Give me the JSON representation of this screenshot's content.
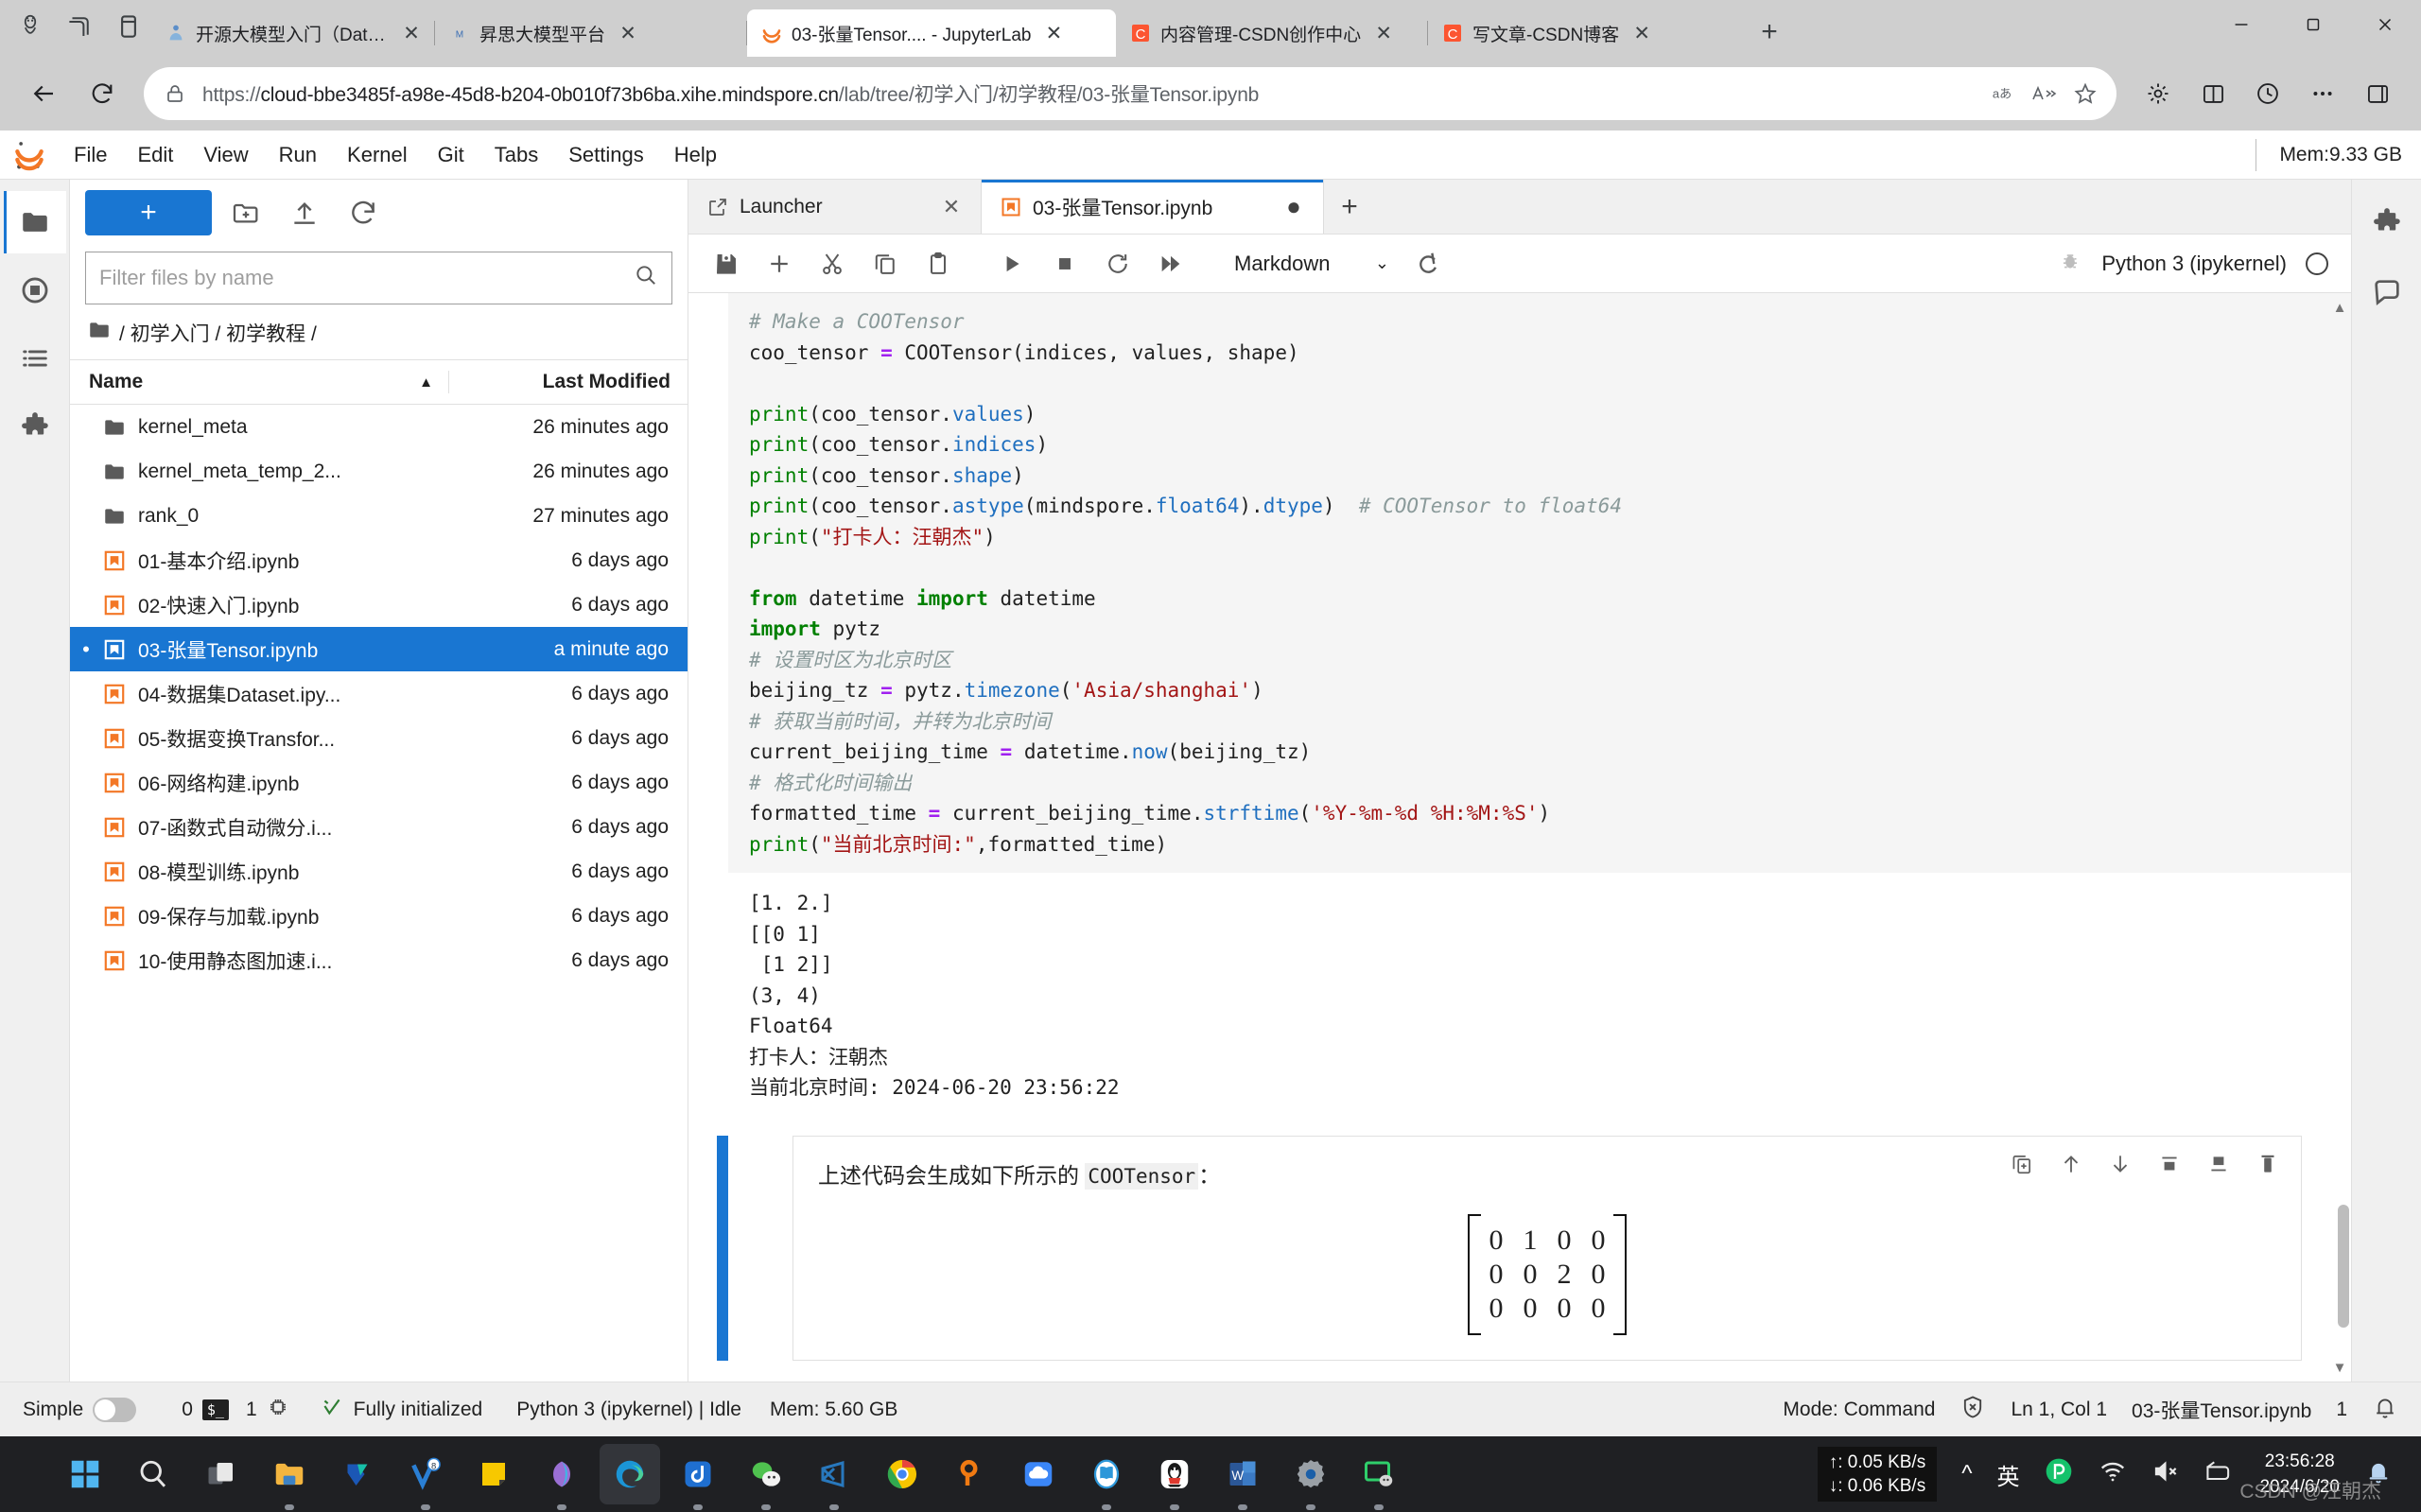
{
  "browser": {
    "tabs": [
      {
        "title": "开源大模型入门（DataWhale）",
        "favicon": "datawhale-icon",
        "active": false
      },
      {
        "title": "昇思大模型平台",
        "favicon": "mindspore-icon",
        "active": false
      },
      {
        "title": "03-张量Tensor.... - JupyterLab",
        "favicon": "jupyter-icon",
        "active": true
      },
      {
        "title": "内容管理-CSDN创作中心",
        "favicon": "csdn-icon",
        "active": false
      },
      {
        "title": "写文章-CSDN博客",
        "favicon": "csdn-icon",
        "active": false
      }
    ],
    "close_label": "✕",
    "newtab_label": "+",
    "window_controls": {
      "minimize": "—",
      "maximize": "❐",
      "close": "✕"
    },
    "url_secure": "https://",
    "url_host": "cloud-bbe3485f-a98e-45d8-b204-0b010f73b6ba.xihe.mindspore.cn",
    "url_path": "/lab/tree/初学入门/初学教程/03-张量Tensor.ipynb",
    "nav": {
      "back": "back-arrow",
      "reload": "reload-icon",
      "translate": "aあ",
      "readaloud": "A≫",
      "favorite": "★",
      "collections": "collections",
      "split": "split-screen",
      "history": "history",
      "more": "⋯",
      "sidebar": "sidebar"
    }
  },
  "jupyter": {
    "menu": [
      "File",
      "Edit",
      "View",
      "Run",
      "Kernel",
      "Git",
      "Tabs",
      "Settings",
      "Help"
    ],
    "memory_badge": "Mem:9.33 GB",
    "left_rail": [
      "file-browser-icon",
      "running-terminals-icon",
      "table-of-contents-icon",
      "extension-manager-icon"
    ],
    "right_rail": [
      "property-inspector-icon",
      "comment-icon"
    ],
    "filebrowser": {
      "new_label": "+",
      "tools": [
        "new-folder-icon",
        "upload-icon",
        "refresh-icon"
      ],
      "filter_placeholder": "Filter files by name",
      "filter_value": "",
      "search_icon": "search-icon",
      "breadcrumb": "/ 初学入门 / 初学教程 /",
      "columns": {
        "name": "Name",
        "modified": "Last Modified"
      },
      "sort_indicator": "▲",
      "items": [
        {
          "name": "kernel_meta",
          "modified": "26 minutes ago",
          "type": "folder",
          "selected": false,
          "running": false
        },
        {
          "name": "kernel_meta_temp_2...",
          "modified": "26 minutes ago",
          "type": "folder",
          "selected": false,
          "running": false
        },
        {
          "name": "rank_0",
          "modified": "27 minutes ago",
          "type": "folder",
          "selected": false,
          "running": false
        },
        {
          "name": "01-基本介绍.ipynb",
          "modified": "6 days ago",
          "type": "notebook",
          "selected": false,
          "running": false
        },
        {
          "name": "02-快速入门.ipynb",
          "modified": "6 days ago",
          "type": "notebook",
          "selected": false,
          "running": false
        },
        {
          "name": "03-张量Tensor.ipynb",
          "modified": "a minute ago",
          "type": "notebook",
          "selected": true,
          "running": true
        },
        {
          "name": "04-数据集Dataset.ipy...",
          "modified": "6 days ago",
          "type": "notebook",
          "selected": false,
          "running": false
        },
        {
          "name": "05-数据变换Transfor...",
          "modified": "6 days ago",
          "type": "notebook",
          "selected": false,
          "running": false
        },
        {
          "name": "06-网络构建.ipynb",
          "modified": "6 days ago",
          "type": "notebook",
          "selected": false,
          "running": false
        },
        {
          "name": "07-函数式自动微分.i...",
          "modified": "6 days ago",
          "type": "notebook",
          "selected": false,
          "running": false
        },
        {
          "name": "08-模型训练.ipynb",
          "modified": "6 days ago",
          "type": "notebook",
          "selected": false,
          "running": false
        },
        {
          "name": "09-保存与加载.ipynb",
          "modified": "6 days ago",
          "type": "notebook",
          "selected": false,
          "running": false
        },
        {
          "name": "10-使用静态图加速.i...",
          "modified": "6 days ago",
          "type": "notebook",
          "selected": false,
          "running": false
        }
      ]
    },
    "doc_tabs": [
      {
        "label": "Launcher",
        "icon": "launcher-icon",
        "active": false,
        "dirty": false,
        "close": "✕"
      },
      {
        "label": "03-张量Tensor.ipynb",
        "icon": "notebook-icon",
        "active": true,
        "dirty": true,
        "close": "●"
      }
    ],
    "doc_tab_add": "+",
    "notebook_toolbar": {
      "buttons": [
        "save-icon",
        "insert-cell-icon",
        "cut-icon",
        "copy-icon",
        "paste-icon",
        "run-icon",
        "stop-icon",
        "restart-icon",
        "restart-run-all-icon"
      ],
      "celltype": "Markdown",
      "celltype_caret": "⌄",
      "extra": "render-all-icon",
      "debugger": "debugger-bug-icon",
      "kernel_name": "Python 3 (ipykernel)",
      "kernel_status": "idle"
    },
    "cells": [
      {
        "type": "code",
        "lines": [
          [
            {
              "t": "# Make a COOTensor",
              "c": "com"
            }
          ],
          [
            {
              "t": "coo_tensor ",
              "c": ""
            },
            {
              "t": "=",
              "c": "op"
            },
            {
              "t": " COOTensor(indices, values, shape)",
              "c": ""
            }
          ],
          [],
          [
            {
              "t": "print",
              "c": "bi"
            },
            {
              "t": "(coo_tensor.",
              "c": ""
            },
            {
              "t": "values",
              "c": "attr"
            },
            {
              "t": ")",
              "c": ""
            }
          ],
          [
            {
              "t": "print",
              "c": "bi"
            },
            {
              "t": "(coo_tensor.",
              "c": ""
            },
            {
              "t": "indices",
              "c": "attr"
            },
            {
              "t": ")",
              "c": ""
            }
          ],
          [
            {
              "t": "print",
              "c": "bi"
            },
            {
              "t": "(coo_tensor.",
              "c": ""
            },
            {
              "t": "shape",
              "c": "attr"
            },
            {
              "t": ")",
              "c": ""
            }
          ],
          [
            {
              "t": "print",
              "c": "bi"
            },
            {
              "t": "(coo_tensor.",
              "c": ""
            },
            {
              "t": "astype",
              "c": "attr"
            },
            {
              "t": "(mindspore.",
              "c": ""
            },
            {
              "t": "float64",
              "c": "attr"
            },
            {
              "t": ").",
              "c": ""
            },
            {
              "t": "dtype",
              "c": "attr"
            },
            {
              "t": ")  ",
              "c": ""
            },
            {
              "t": "# COOTensor to float64",
              "c": "com"
            }
          ],
          [
            {
              "t": "print",
              "c": "bi"
            },
            {
              "t": "(",
              "c": ""
            },
            {
              "t": "\"打卡人：汪朝杰\"",
              "c": "str"
            },
            {
              "t": ")",
              "c": ""
            }
          ],
          [],
          [
            {
              "t": "from",
              "c": "kw"
            },
            {
              "t": " datetime ",
              "c": ""
            },
            {
              "t": "import",
              "c": "kw"
            },
            {
              "t": " datetime",
              "c": ""
            }
          ],
          [
            {
              "t": "import",
              "c": "kw"
            },
            {
              "t": " pytz",
              "c": ""
            }
          ],
          [
            {
              "t": "# 设置时区为北京时区",
              "c": "com"
            }
          ],
          [
            {
              "t": "beijing_tz ",
              "c": ""
            },
            {
              "t": "=",
              "c": "op"
            },
            {
              "t": " pytz.",
              "c": ""
            },
            {
              "t": "timezone",
              "c": "attr"
            },
            {
              "t": "(",
              "c": ""
            },
            {
              "t": "'Asia/shanghai'",
              "c": "str"
            },
            {
              "t": ")",
              "c": ""
            }
          ],
          [
            {
              "t": "# 获取当前时间，并转为北京时间",
              "c": "com"
            }
          ],
          [
            {
              "t": "current_beijing_time ",
              "c": ""
            },
            {
              "t": "=",
              "c": "op"
            },
            {
              "t": " datetime.",
              "c": ""
            },
            {
              "t": "now",
              "c": "attr"
            },
            {
              "t": "(beijing_tz)",
              "c": ""
            }
          ],
          [
            {
              "t": "# 格式化时间输出",
              "c": "com"
            }
          ],
          [
            {
              "t": "formatted_time ",
              "c": ""
            },
            {
              "t": "=",
              "c": "op"
            },
            {
              "t": " current_beijing_time.",
              "c": ""
            },
            {
              "t": "strftime",
              "c": "attr"
            },
            {
              "t": "(",
              "c": ""
            },
            {
              "t": "'%Y-%m-%d %H:%M:%S'",
              "c": "str"
            },
            {
              "t": ")",
              "c": ""
            }
          ],
          [
            {
              "t": "print",
              "c": "bi"
            },
            {
              "t": "(",
              "c": ""
            },
            {
              "t": "\"当前北京时间:\"",
              "c": "str"
            },
            {
              "t": ",formatted_time)",
              "c": ""
            }
          ]
        ],
        "output": [
          "[1. 2.]",
          "[[0 1]",
          " [1 2]]",
          "(3, 4)",
          "Float64",
          "打卡人：汪朝杰",
          "当前北京时间: 2024-06-20 23:56:22"
        ]
      },
      {
        "type": "markdown",
        "selected": true,
        "text_before": "上述代码会生成如下所示的 ",
        "text_code": "COOTensor",
        "text_after": "：",
        "toolbar": [
          "duplicate-icon",
          "move-up-icon",
          "move-down-icon",
          "insert-above-icon",
          "insert-below-icon",
          "delete-icon"
        ],
        "matrix": [
          [
            "0",
            "1",
            "0",
            "0"
          ],
          [
            "0",
            "0",
            "2",
            "0"
          ],
          [
            "0",
            "0",
            "0",
            "0"
          ]
        ]
      }
    ],
    "statusbar": {
      "simple_label": "Simple",
      "simple_on": false,
      "terminals_count": "0",
      "terminal_icon": "terminal-icon",
      "kernels_count": "1",
      "kernel_icon": "cpu-icon",
      "init_icon": "check-icon",
      "init_text": "Fully initialized",
      "kernel_text": "Python 3 (ipykernel) | Idle",
      "mem_text": "Mem: 5.60 GB",
      "mode_text": "Mode: Command",
      "shield_icon": "no-connection-icon",
      "position_text": "Ln 1, Col 1",
      "file_text": "03-张量Tensor.ipynb",
      "notif_count": "1",
      "bell_icon": "bell-icon"
    }
  },
  "taskbar": {
    "apps": [
      {
        "name": "start-button",
        "active": false,
        "running": false
      },
      {
        "name": "search-icon",
        "active": false,
        "running": false
      },
      {
        "name": "task-view-icon",
        "active": false,
        "running": false
      },
      {
        "name": "file-explorer-icon",
        "active": false,
        "running": true
      },
      {
        "name": "onedrive-icon",
        "active": false,
        "running": false
      },
      {
        "name": "wps-icon",
        "active": false,
        "running": true,
        "badge": "8"
      },
      {
        "name": "sticky-notes-icon",
        "active": false,
        "running": false
      },
      {
        "name": "copilot-icon",
        "active": false,
        "running": true
      },
      {
        "name": "edge-icon",
        "active": true,
        "running": true
      },
      {
        "name": "douyin-icon",
        "active": false,
        "running": true
      },
      {
        "name": "wechat-icon",
        "active": false,
        "running": true
      },
      {
        "name": "vscode-icon",
        "active": false,
        "running": true
      },
      {
        "name": "chrome-icon",
        "active": false,
        "running": false
      },
      {
        "name": "keyword-icon",
        "active": false,
        "running": false
      },
      {
        "name": "baidu-netdisk-icon",
        "active": false,
        "running": false
      },
      {
        "name": "dictionary-icon",
        "active": false,
        "running": true
      },
      {
        "name": "qq-icon",
        "active": false,
        "running": true
      },
      {
        "name": "word-icon",
        "active": false,
        "running": true
      },
      {
        "name": "settings-icon",
        "active": false,
        "running": true
      },
      {
        "name": "screen-share-icon",
        "active": false,
        "running": true
      }
    ],
    "net_up": "↑: 0.05 KB/s",
    "net_down": "↓: 0.06 KB/s",
    "tray": {
      "chevron": "^",
      "ime": "英",
      "pinyin_icon": "pinyin-icon",
      "wifi_icon": "wifi-icon",
      "volume_icon": "volume-muted-icon",
      "battery_icon": "battery-icon",
      "bell_icon": "bell-icon"
    },
    "clock_time": "23:56:28",
    "clock_date": "2024/6/20"
  },
  "watermark": "CSDN @汪朝杰"
}
